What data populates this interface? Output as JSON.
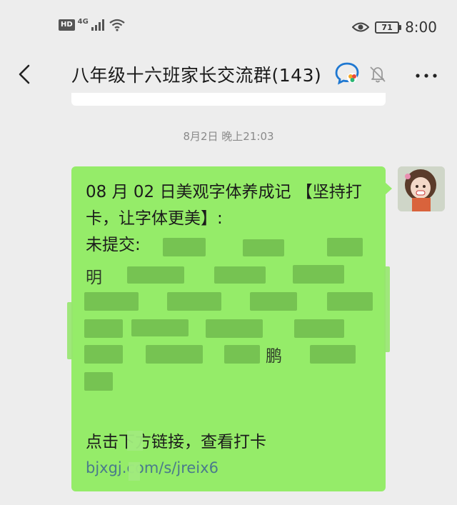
{
  "status_bar": {
    "hd_label": "HD",
    "network_label": "4G",
    "battery_level": "71",
    "time": "8:00",
    "icons": [
      "signal-icon",
      "wifi-icon",
      "eye-icon",
      "battery-icon"
    ]
  },
  "header": {
    "title": "八年级十六班家长交流群(143)",
    "icons": [
      "back-arrow-icon",
      "group-chat-icon",
      "mute-bell-icon",
      "more-dots-icon"
    ]
  },
  "chat": {
    "timestamp": "8月2日 晚上21:03",
    "message": {
      "headline": "08 月 02 日美观字体养成记 【坚持打卡，让字体更美】:",
      "not_submitted_label": "未提交:",
      "visible_fragments": [
        "明",
        "鹏"
      ],
      "action_text": "点击下方链接，查看打卡",
      "url": "bjxgj.com/s/jreix6"
    },
    "bubble_color": "#95ec69"
  }
}
